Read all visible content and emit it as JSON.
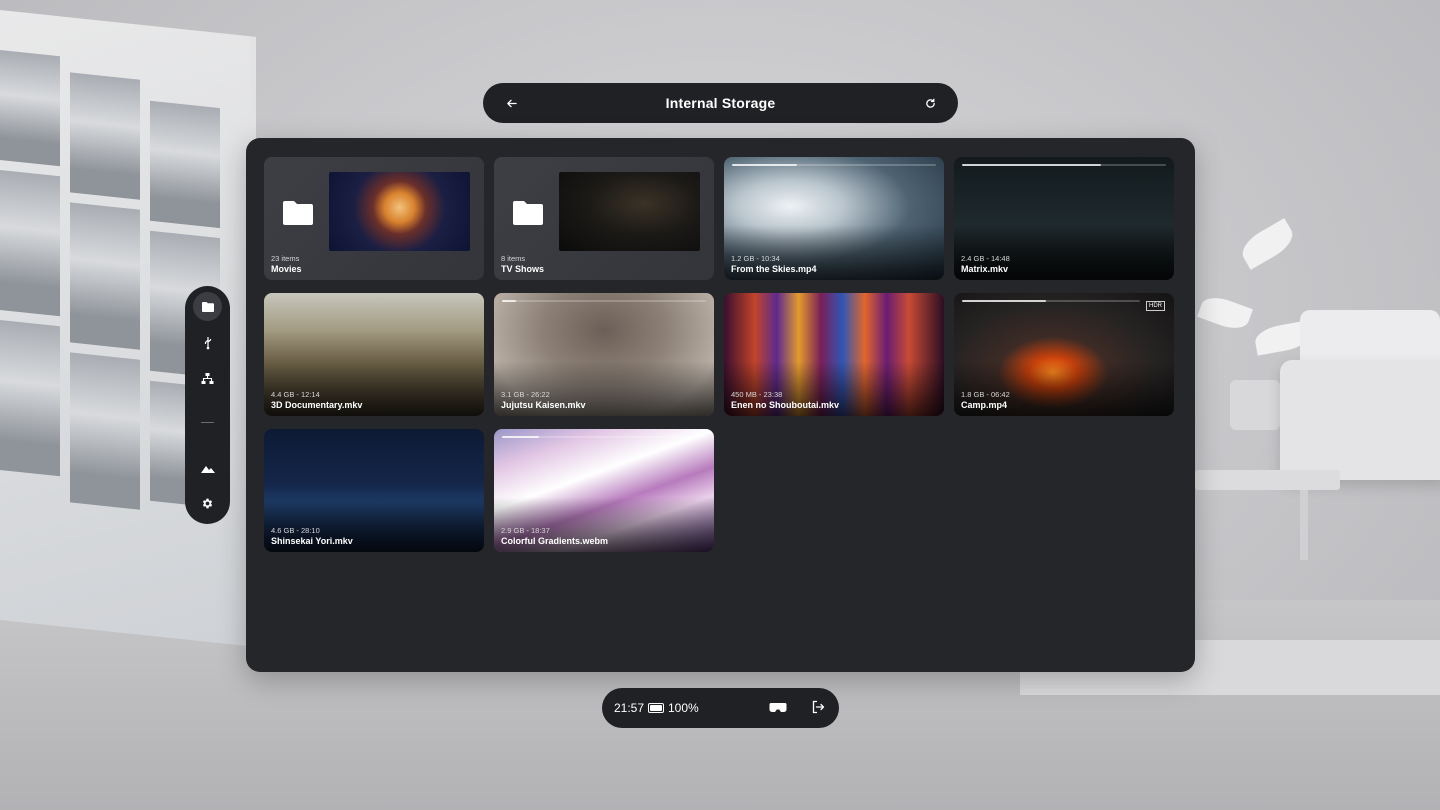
{
  "header": {
    "title": "Internal Storage",
    "back_icon": "arrow-left-icon",
    "refresh_icon": "refresh-icon"
  },
  "sidebar": {
    "items": [
      {
        "icon": "folder-icon",
        "active": true
      },
      {
        "icon": "usb-icon",
        "active": false
      },
      {
        "icon": "network-icon",
        "active": false
      },
      {
        "icon": "mountain-icon",
        "active": false
      },
      {
        "icon": "gear-icon",
        "active": false
      }
    ]
  },
  "files": [
    {
      "kind": "folder",
      "meta": "23 items",
      "name": "Movies"
    },
    {
      "kind": "folder",
      "meta": "8 items",
      "name": "TV Shows"
    },
    {
      "kind": "video",
      "meta": "1.2 GB - 10:34",
      "name": "From the Skies.mp4",
      "progress": 0.32
    },
    {
      "kind": "video",
      "meta": "2.4 GB - 14:48",
      "name": "Matrix.mkv",
      "progress": 0.68
    },
    {
      "kind": "video",
      "meta": "4.4 GB - 12:14",
      "name": "3D Documentary.mkv"
    },
    {
      "kind": "video",
      "meta": "3.1 GB - 26:22",
      "name": "Jujutsu Kaisen.mkv",
      "progress": 0.07
    },
    {
      "kind": "video",
      "meta": "450 MB - 23:38",
      "name": "Enen no Shouboutai.mkv"
    },
    {
      "kind": "video",
      "meta": "1.8 GB - 06:42",
      "name": "Camp.mp4",
      "progress": 0.47,
      "badge": "HDR"
    },
    {
      "kind": "video",
      "meta": "4.6 GB - 28:10",
      "name": "Shinsekai Yori.mkv"
    },
    {
      "kind": "video",
      "meta": "2.9 GB - 18:37",
      "name": "Colorful Gradients.webm",
      "progress": 0.18
    }
  ],
  "statusbar": {
    "time": "21:57",
    "battery": "100%",
    "battery_level": 1.0,
    "vr_icon": "vr-headset-icon",
    "exit_icon": "exit-icon"
  },
  "colors": {
    "panel": "#25262a",
    "bar": "#202124",
    "text": "#ffffff"
  }
}
